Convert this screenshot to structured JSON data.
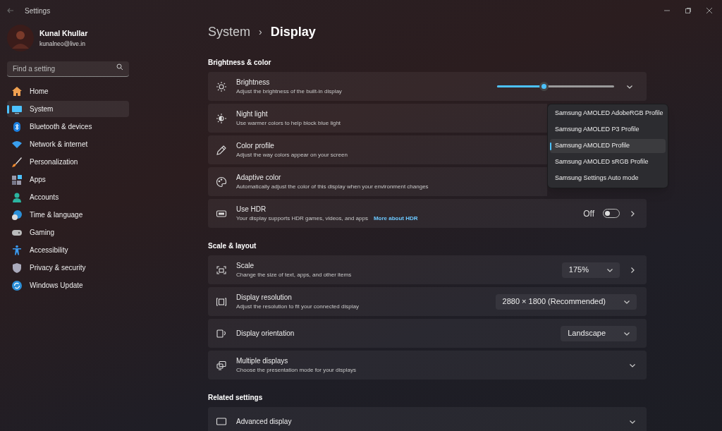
{
  "window": {
    "title": "Settings"
  },
  "profile": {
    "name": "Kunal Khullar",
    "email": "kunalneo@live.in"
  },
  "search": {
    "placeholder": "Find a setting"
  },
  "nav": [
    {
      "label": "Home",
      "selected": false
    },
    {
      "label": "System",
      "selected": true
    },
    {
      "label": "Bluetooth & devices",
      "selected": false
    },
    {
      "label": "Network & internet",
      "selected": false
    },
    {
      "label": "Personalization",
      "selected": false
    },
    {
      "label": "Apps",
      "selected": false
    },
    {
      "label": "Accounts",
      "selected": false
    },
    {
      "label": "Time & language",
      "selected": false
    },
    {
      "label": "Gaming",
      "selected": false
    },
    {
      "label": "Accessibility",
      "selected": false
    },
    {
      "label": "Privacy & security",
      "selected": false
    },
    {
      "label": "Windows Update",
      "selected": false
    }
  ],
  "breadcrumb": {
    "parent": "System",
    "separator": "›",
    "current": "Display"
  },
  "sections": [
    {
      "title": "Brightness & color",
      "rows": [
        {
          "kind": "slider",
          "title": "Brightness",
          "subtitle": "Adjust the brightness of the built-in display",
          "level": 0.4
        },
        {
          "kind": "plain",
          "title": "Night light",
          "subtitle": "Use warmer colors to help block blue light"
        },
        {
          "kind": "plain",
          "title": "Color profile",
          "subtitle": "Adjust the way colors appear on your screen"
        },
        {
          "kind": "plain",
          "title": "Adaptive color",
          "subtitle": "Automatically adjust the color of this display when your environment changes"
        },
        {
          "kind": "toggle",
          "title": "Use HDR",
          "subtitle": "Your display supports HDR games, videos, and apps",
          "link": "More about HDR",
          "on": false,
          "state_label": "Off"
        }
      ]
    },
    {
      "title": "Scale & layout",
      "rows": [
        {
          "kind": "dropdown",
          "title": "Scale",
          "subtitle": "Change the size of text, apps, and other items",
          "value": "175%",
          "arrow": true
        },
        {
          "kind": "dropdown",
          "title": "Display resolution",
          "subtitle": "Adjust the resolution to fit your connected display",
          "value": "2880 × 1800 (Recommended)",
          "arrow": false
        },
        {
          "kind": "dropdown",
          "title": "Display orientation",
          "value": "Landscape",
          "arrow": false
        },
        {
          "kind": "expand",
          "title": "Multiple displays",
          "subtitle": "Choose the presentation mode for your displays"
        }
      ]
    },
    {
      "title": "Related settings",
      "rows": [
        {
          "kind": "expand",
          "title": "Advanced display"
        }
      ]
    }
  ],
  "profile_menu": {
    "items": [
      {
        "label": "Samsung AMOLED AdobeRGB Profile",
        "selected": false
      },
      {
        "label": "Samsung AMOLED P3 Profile",
        "selected": false
      },
      {
        "label": "Samsung AMOLED Profile",
        "selected": true
      },
      {
        "label": "Samsung AMOLED sRGB Profile",
        "selected": false
      },
      {
        "label": "Samsung Settings Auto mode",
        "selected": false
      }
    ]
  }
}
